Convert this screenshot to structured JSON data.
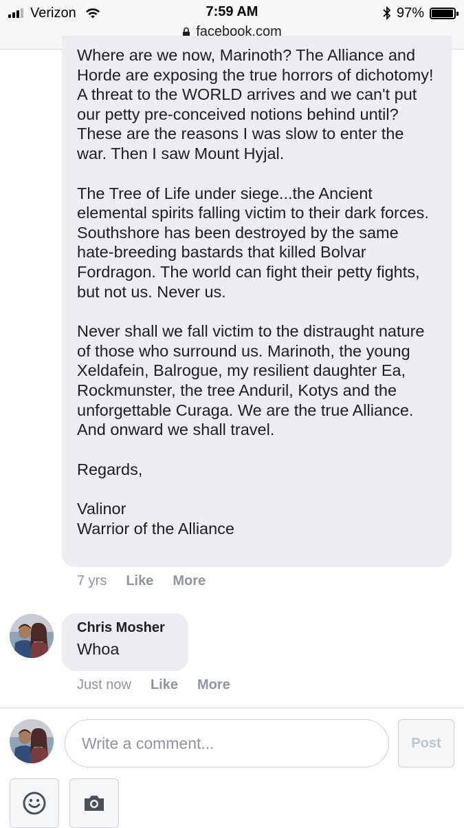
{
  "status_bar": {
    "carrier": "Verizon",
    "time": "7:59 AM",
    "battery_percent": "97%",
    "battery_level": 0.97,
    "url": "facebook.com"
  },
  "comment_1": {
    "paragraphs": [
      "Where are we now, Marinoth? The Alliance and Horde are exposing the true horrors of dichotomy! A threat to the WORLD arrives and we can't put our petty pre-conceived notions behind until? These are the reasons I was slow to enter the war. Then I saw Mount Hyjal.",
      "The Tree of Life under siege...the Ancient elemental spirits falling victim to their dark forces. Southshore has been destroyed by the same hate-breeding bastards that killed Bolvar Fordragon. The world can fight their petty fights, but not us. Never us.",
      "Never shall we fall victim to the distraught nature of those who surround us. Marinoth, the young Xeldafein, Balrogue, my resilient daughter Ea, Rockmunster, the tree Anduril, Kotys and the unforgettable Curaga. We are the true Alliance. And onward we shall travel.",
      "Regards,"
    ],
    "signature_name": "Valinor",
    "signature_title": "Warrior of the Alliance",
    "timestamp": "7 yrs",
    "like_label": "Like",
    "more_label": "More"
  },
  "comment_2": {
    "author": "Chris Mosher",
    "text": "Whoa",
    "timestamp": "Just now",
    "like_label": "Like",
    "more_label": "More"
  },
  "composer": {
    "placeholder": "Write a comment...",
    "post_label": "Post",
    "emoji_icon": "smiley-icon",
    "camera_icon": "camera-icon"
  },
  "colors": {
    "bubble": "#ebedf0",
    "meta_text": "#90949c",
    "text": "#1c1e21"
  }
}
